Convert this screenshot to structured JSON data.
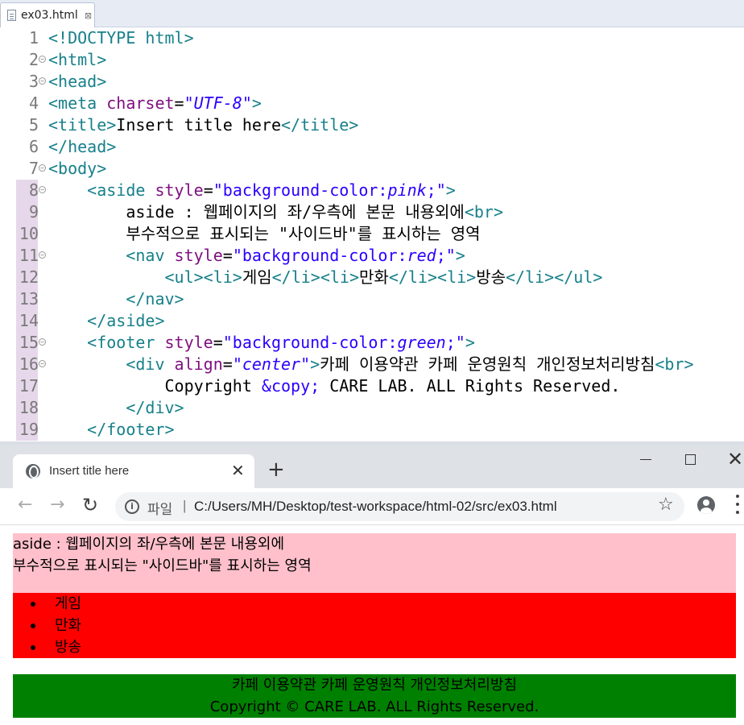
{
  "editor": {
    "tab_name": "ex03.html",
    "tab_close": "⊠",
    "lines": [
      {
        "n": "1",
        "segs": [
          [
            "t-doctype",
            "<!DOCTYPE html>"
          ]
        ]
      },
      {
        "n": "2",
        "fold": true,
        "segs": [
          [
            "t-tag",
            "<html>"
          ]
        ]
      },
      {
        "n": "3",
        "fold": true,
        "segs": [
          [
            "t-tag",
            "<head>"
          ]
        ]
      },
      {
        "n": "4",
        "segs": [
          [
            "t-tag",
            "<meta "
          ],
          [
            "t-attr",
            "charset"
          ],
          [
            "t-text",
            "="
          ],
          [
            "t-val",
            "\"UTF-8\""
          ],
          [
            "t-tag",
            ">"
          ]
        ]
      },
      {
        "n": "5",
        "segs": [
          [
            "t-tag",
            "<title>"
          ],
          [
            "t-text",
            "Insert title here"
          ],
          [
            "t-tag",
            "</title>"
          ]
        ]
      },
      {
        "n": "6",
        "segs": [
          [
            "t-tag",
            "</head>"
          ]
        ]
      },
      {
        "n": "7",
        "fold": true,
        "segs": [
          [
            "t-tag",
            "<body>"
          ]
        ]
      },
      {
        "n": "8",
        "fold": true,
        "segs": [
          [
            "t-text",
            "    "
          ],
          [
            "t-tag",
            "<aside "
          ],
          [
            "t-attr",
            "style"
          ],
          [
            "t-text",
            "="
          ],
          [
            "t-str",
            "\"background-color:"
          ],
          [
            "t-val",
            "pink"
          ],
          [
            "t-str",
            ";\""
          ],
          [
            "t-tag",
            ">"
          ]
        ]
      },
      {
        "n": "9",
        "segs": [
          [
            "t-text",
            "        aside : 웹페이지의 좌/우측에 본문 내용외에"
          ],
          [
            "t-tag",
            "<br>"
          ]
        ]
      },
      {
        "n": "10",
        "segs": [
          [
            "t-text",
            "        부수적으로 표시되는 \"사이드바\"를 표시하는 영역"
          ]
        ]
      },
      {
        "n": "11",
        "fold": true,
        "segs": [
          [
            "t-text",
            "        "
          ],
          [
            "t-tag",
            "<nav "
          ],
          [
            "t-attr",
            "style"
          ],
          [
            "t-text",
            "="
          ],
          [
            "t-str",
            "\"background-color:"
          ],
          [
            "t-val",
            "red"
          ],
          [
            "t-str",
            ";\""
          ],
          [
            "t-tag",
            ">"
          ]
        ]
      },
      {
        "n": "12",
        "segs": [
          [
            "t-text",
            "            "
          ],
          [
            "t-tag",
            "<ul><li>"
          ],
          [
            "t-text",
            "게임"
          ],
          [
            "t-tag",
            "</li><li>"
          ],
          [
            "t-text",
            "만화"
          ],
          [
            "t-tag",
            "</li><li>"
          ],
          [
            "t-text",
            "방송"
          ],
          [
            "t-tag",
            "</li></ul>"
          ]
        ]
      },
      {
        "n": "13",
        "segs": [
          [
            "t-text",
            "        "
          ],
          [
            "t-tag",
            "</nav>"
          ]
        ]
      },
      {
        "n": "14",
        "segs": [
          [
            "t-text",
            "    "
          ],
          [
            "t-tag",
            "</aside>"
          ]
        ]
      },
      {
        "n": "15",
        "fold": true,
        "segs": [
          [
            "t-text",
            "    "
          ],
          [
            "t-tag",
            "<footer "
          ],
          [
            "t-attr",
            "style"
          ],
          [
            "t-text",
            "="
          ],
          [
            "t-str",
            "\"background-color:"
          ],
          [
            "t-val",
            "green"
          ],
          [
            "t-str",
            ";\""
          ],
          [
            "t-tag",
            ">"
          ]
        ]
      },
      {
        "n": "16",
        "fold": true,
        "segs": [
          [
            "t-text",
            "        "
          ],
          [
            "t-tag",
            "<div "
          ],
          [
            "t-attr",
            "align"
          ],
          [
            "t-text",
            "="
          ],
          [
            "t-val",
            "\"center\""
          ],
          [
            "t-tag",
            ">"
          ],
          [
            "t-text",
            "카페 이용약관 카페 운영원칙 개인정보처리방침"
          ],
          [
            "t-tag",
            "<br>"
          ]
        ]
      },
      {
        "n": "17",
        "segs": [
          [
            "t-text",
            "            Copyright "
          ],
          [
            "t-ent",
            "&copy;"
          ],
          [
            "t-text",
            " CARE LAB. ALL Rights Reserved."
          ]
        ]
      },
      {
        "n": "18",
        "segs": [
          [
            "t-text",
            "        "
          ],
          [
            "t-tag",
            "</div>"
          ]
        ]
      },
      {
        "n": "19",
        "segs": [
          [
            "t-text",
            "    "
          ],
          [
            "t-tag",
            "</footer>"
          ]
        ]
      }
    ]
  },
  "browser": {
    "tab_title": "Insert title here",
    "tab_close": "✕",
    "new_tab": "+",
    "window_close": "✕",
    "nav_back": "←",
    "nav_forward": "→",
    "nav_reload": "↻",
    "info_glyph": "i",
    "scheme_label": "파일",
    "separator": "|",
    "url": "C:/Users/MH/Desktop/test-workspace/html-02/src/ex03.html",
    "star_glyph": "☆"
  },
  "page": {
    "aside_line1": "aside : 웹페이지의 좌/우측에 본문 내용외에",
    "aside_line2": "부수적으로 표시되는 \"사이드바\"를 표시하는 영역",
    "nav_items": [
      "게임",
      "만화",
      "방송"
    ],
    "footer_line1": "카페 이용약관 카페 운영원칙 개인정보처리방침",
    "footer_line2": "Copyright © CARE LAB. ALL Rights Reserved."
  },
  "colors": {
    "aside_bg": "pink",
    "nav_bg": "red",
    "footer_bg": "green",
    "tag": "#17808a",
    "attr": "#7f0f7f",
    "value": "#2a00ff"
  },
  "icons": [
    "file-icon",
    "globe-icon",
    "info-icon",
    "star-icon",
    "profile-icon",
    "menu-icon"
  ]
}
